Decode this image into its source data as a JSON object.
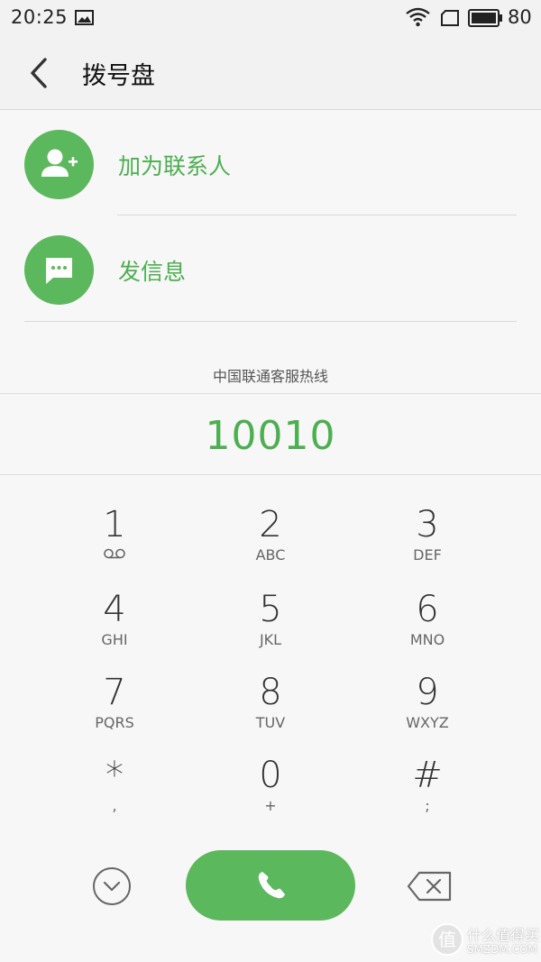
{
  "status_bar": {
    "time": "20:25",
    "battery": "80",
    "icons": [
      "image-icon",
      "wifi-icon",
      "sim-icon",
      "battery-icon"
    ]
  },
  "header": {
    "title": "拨号盘",
    "back_icon": "back-arrow-icon"
  },
  "actions": [
    {
      "label": "加为联系人",
      "icon": "add-contact-icon"
    },
    {
      "label": "发信息",
      "icon": "message-icon"
    }
  ],
  "caller_label": "中国联通客服热线",
  "dialed_number": "10010",
  "keypad": [
    {
      "digit": "1",
      "letters": "",
      "sub_icon": "voicemail-icon"
    },
    {
      "digit": "2",
      "letters": "ABC"
    },
    {
      "digit": "3",
      "letters": "DEF"
    },
    {
      "digit": "4",
      "letters": "GHI"
    },
    {
      "digit": "5",
      "letters": "JKL"
    },
    {
      "digit": "6",
      "letters": "MNO"
    },
    {
      "digit": "7",
      "letters": "PQRS"
    },
    {
      "digit": "8",
      "letters": "TUV"
    },
    {
      "digit": "9",
      "letters": "WXYZ"
    },
    {
      "digit": "*",
      "letters": ","
    },
    {
      "digit": "0",
      "letters": "+"
    },
    {
      "digit": "#",
      "letters": ";"
    }
  ],
  "bottom_bar": {
    "collapse_icon": "chevron-down-circle-icon",
    "call_icon": "phone-icon",
    "delete_icon": "backspace-icon"
  },
  "watermark": {
    "logo": "值",
    "text": "什么值得买",
    "sub": "SMZDM.COM"
  },
  "colors": {
    "accent": "#5cb85c",
    "accent_text": "#4caf50",
    "background": "#f7f7f7"
  }
}
